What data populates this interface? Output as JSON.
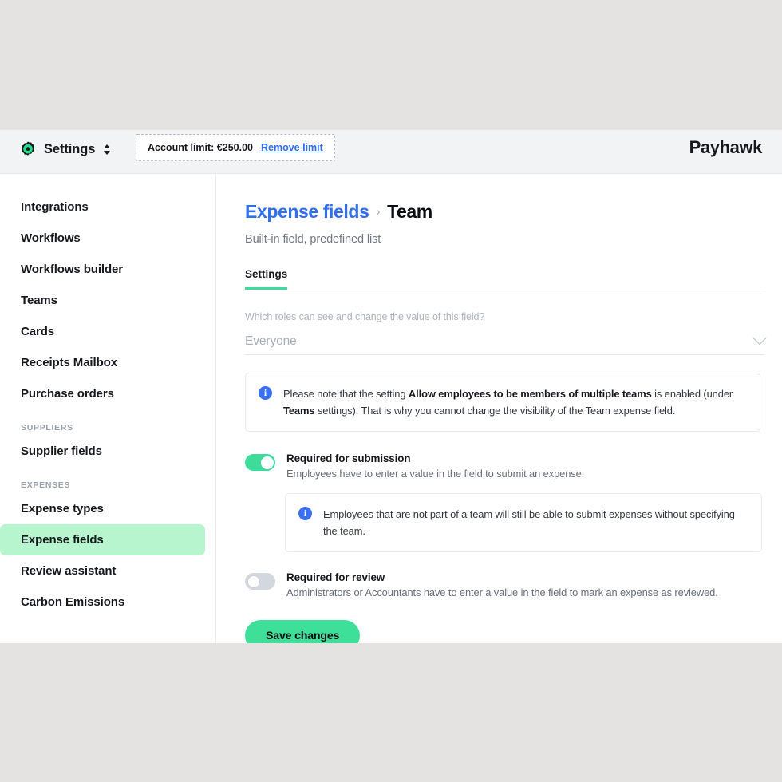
{
  "topbar": {
    "gear_icon": "gear-icon",
    "settings_label": "Settings",
    "switcher_icon": "up-down-chevron-icon",
    "account_limit_text": "Account limit: €250.00",
    "remove_limit_label": "Remove limit",
    "brand": "Payhawk"
  },
  "sidebar": {
    "items": [
      {
        "label": "Integrations",
        "type": "item",
        "active": false
      },
      {
        "label": "Workflows",
        "type": "item",
        "active": false
      },
      {
        "label": "Workflows builder",
        "type": "item",
        "active": false
      },
      {
        "label": "Teams",
        "type": "item",
        "active": false
      },
      {
        "label": "Cards",
        "type": "item",
        "active": false
      },
      {
        "label": "Receipts Mailbox",
        "type": "item",
        "active": false
      },
      {
        "label": "Purchase orders",
        "type": "item",
        "active": false
      },
      {
        "label": "SUPPLIERS",
        "type": "group",
        "active": false
      },
      {
        "label": "Supplier fields",
        "type": "item",
        "active": false
      },
      {
        "label": "EXPENSES",
        "type": "group",
        "active": false
      },
      {
        "label": "Expense types",
        "type": "item",
        "active": false
      },
      {
        "label": "Expense fields",
        "type": "item",
        "active": true
      },
      {
        "label": "Review assistant",
        "type": "item",
        "active": false
      },
      {
        "label": "Carbon Emissions",
        "type": "item",
        "active": false
      }
    ]
  },
  "main": {
    "breadcrumb": {
      "parent": "Expense fields",
      "separator": "›",
      "current": "Team"
    },
    "subtitle": "Built-in field, predefined list",
    "tabs": [
      {
        "label": "Settings",
        "active": true
      }
    ],
    "roles_select": {
      "label": "Which roles can see and change the value of this field?",
      "value": "Everyone",
      "chevron_icon": "chevron-down-icon",
      "disabled": true
    },
    "note_visibility": {
      "icon": "info-icon",
      "icon_glyph": "i",
      "part1": "Please note that the setting ",
      "bold1": "Allow employees to be members of multiple teams",
      "part2": " is enabled (under ",
      "bold2": "Teams",
      "part3": " settings). That is why you cannot change the visibility of the Team expense field."
    },
    "toggle_submission": {
      "state": "on",
      "title": "Required for submission",
      "description": "Employees have to enter a value in the field to submit an expense."
    },
    "note_submission": {
      "icon": "info-icon",
      "icon_glyph": "i",
      "text": "Employees that are not part of a team will still be able to submit expenses without specifying the team."
    },
    "toggle_review": {
      "state": "off",
      "title": "Required for review",
      "description": "Administrators or Accountants have to enter a value in the field to mark an expense as reviewed."
    },
    "save_button_label": "Save changes"
  },
  "colors": {
    "accent_green": "#3edc9a",
    "link_blue": "#2f6ff0",
    "info_blue": "#3b6ff0",
    "active_nav_bg": "#b7f5cf",
    "page_backdrop": "#e4e3e1"
  }
}
